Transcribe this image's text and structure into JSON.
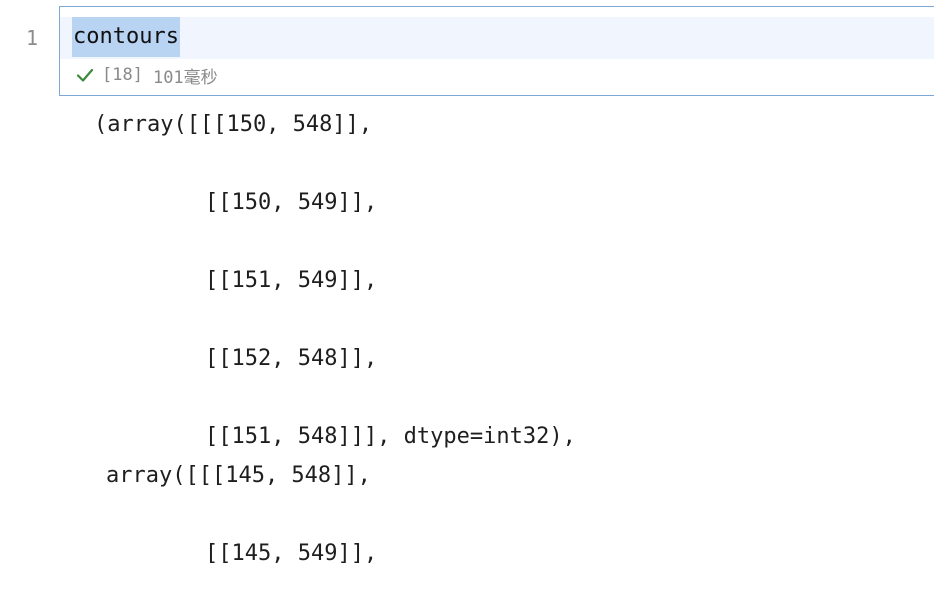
{
  "editor": {
    "line_number": "1",
    "code": "contours",
    "execution": {
      "status_icon": "check-icon",
      "status_color": "#3b8a3e",
      "exec_count": "[18]",
      "duration": "101毫秒"
    }
  },
  "output": {
    "lines": [
      "(array([[[150, 548]],",
      "[[150, 549]],",
      "[[151, 549]],",
      "[[152, 548]],",
      "[[151, 548]]], dtype=int32),",
      "array([[[145, 548]],",
      "[[145, 549]],"
    ]
  }
}
